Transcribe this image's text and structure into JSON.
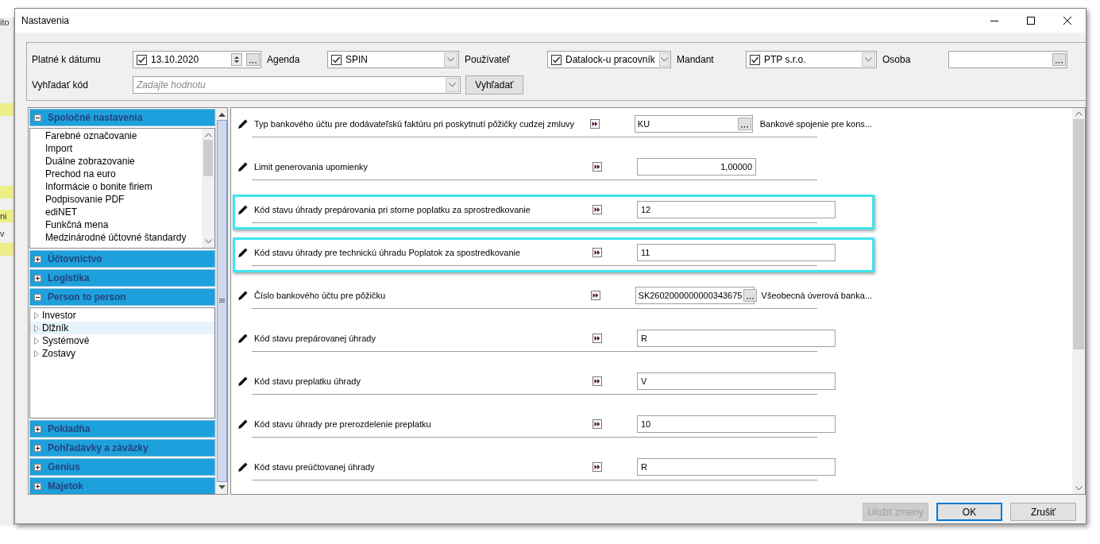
{
  "background_app": {
    "fragments": [
      "ito",
      "ni",
      "v"
    ]
  },
  "window": {
    "title": "Nastavenia"
  },
  "filters": [
    {
      "kind": "date",
      "label": "Platné k dátumu",
      "value": "13.10.2020",
      "checked": true
    },
    {
      "kind": "combo",
      "label": "Agenda",
      "value": "SPIN",
      "checked": true
    },
    {
      "kind": "combo",
      "label": "Používateľ",
      "value": "Datalock-u pracovník",
      "checked": true
    },
    {
      "kind": "combo",
      "label": "Mandant",
      "value": "PTP s.r.o.",
      "checked": true
    },
    {
      "kind": "lookup",
      "label": "Osoba"
    }
  ],
  "search": {
    "label": "Vyhľadať kód",
    "placeholder": "Zadajte hodnotu",
    "button": "Vyhľadať"
  },
  "sections": [
    {
      "title": "Spoločné nastavenia",
      "expanded": true,
      "kind": "list",
      "items": [
        "Farebné označovanie",
        "Import",
        "Duálne zobrazovanie",
        "Prechod na euro",
        "Informácie o bonite firiem",
        "Podpisovanie PDF",
        "ediNET",
        "Funkčná mena",
        "Medzinárodné účtovné štandardy"
      ]
    },
    {
      "title": "Účtovníctvo",
      "expanded": false
    },
    {
      "title": "Logistika",
      "expanded": false
    },
    {
      "title": "Person to person",
      "expanded": true,
      "kind": "tree",
      "items": [
        {
          "label": "Investor",
          "selected": false
        },
        {
          "label": "Dlžník",
          "selected": true
        },
        {
          "label": "Systémové",
          "selected": false
        },
        {
          "label": "Zostavy",
          "selected": false
        }
      ]
    },
    {
      "title": "Pokladňa",
      "expanded": false
    },
    {
      "title": "Pohľadávky a záväzky",
      "expanded": false
    },
    {
      "title": "Genius",
      "expanded": false
    },
    {
      "title": "Majetok",
      "expanded": false
    }
  ],
  "settings": [
    {
      "kind": "lookup",
      "label": "Typ bankového účtu pre dodávateľskú faktúru pri poskytnutí pôžičky cudzej zmluvy",
      "value": "KU",
      "description": "Bankové spojenie pre kons...",
      "highlighted": false
    },
    {
      "kind": "number",
      "label": "Limit generovania upomienky",
      "value": "1,00000",
      "highlighted": false
    },
    {
      "kind": "text",
      "label": "Kód stavu úhrady prepárovania pri storne poplatku za sprostredkovanie",
      "value": "12",
      "highlighted": true
    },
    {
      "kind": "text",
      "label": "Kód stavu úhrady pre technickú úhradu Poplatok za spostredkovanie",
      "value": "11",
      "highlighted": true
    },
    {
      "kind": "lookup",
      "label": "Číslo bankového účtu pre pôžičku",
      "value": "SK2602000000000343675",
      "description": "Všeobecná úverová banka...",
      "highlighted": false
    },
    {
      "kind": "text",
      "label": "Kód stavu prepárovanej úhrady",
      "value": "R",
      "highlighted": false
    },
    {
      "kind": "text",
      "label": "Kód stavu preplatku úhrady",
      "value": "V",
      "highlighted": false
    },
    {
      "kind": "text",
      "label": "Kód stavu úhrady pre prerozdelenie preplatku",
      "value": "10",
      "highlighted": false
    },
    {
      "kind": "text",
      "label": "Kód stavu preúčtovanej úhrady",
      "value": "R",
      "highlighted": false
    }
  ],
  "buttons": [
    {
      "label": "Uložiť zmeny",
      "disabled": true,
      "default": false
    },
    {
      "label": "OK",
      "disabled": false,
      "default": true
    },
    {
      "label": "Zrušiť",
      "disabled": false,
      "default": false
    }
  ]
}
